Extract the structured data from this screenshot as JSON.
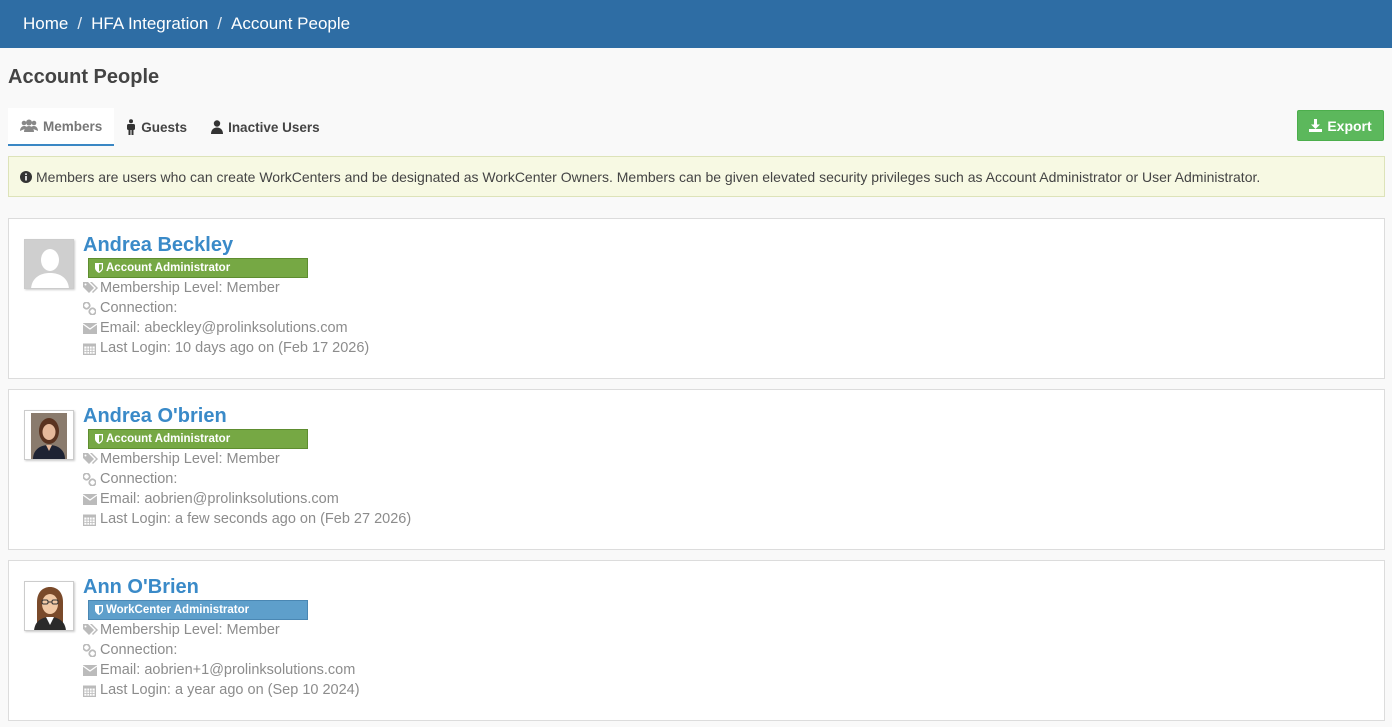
{
  "breadcrumb": [
    {
      "label": "Home"
    },
    {
      "label": "HFA Integration"
    },
    {
      "label": "Account People"
    }
  ],
  "page_title": "Account People",
  "tabs": [
    {
      "label": "Members",
      "icon": "users-icon",
      "active": true
    },
    {
      "label": "Guests",
      "icon": "male-icon",
      "active": false
    },
    {
      "label": "Inactive Users",
      "icon": "user-icon",
      "active": false
    }
  ],
  "export_label": "Export",
  "info_text": "Members are users who can create WorkCenters and be designated as WorkCenter Owners. Members can be given elevated security privileges such as Account Administrator or User Administrator.",
  "colors": {
    "topbar": "#2e6da4",
    "admin_badge": "#76a844",
    "workcenter_badge": "#5e9fcb",
    "name_link": "#3a8ac8",
    "export": "#5cb85c"
  },
  "people": [
    {
      "name": "Andrea Beckley",
      "avatar": "default-avatar",
      "role": "Account Administrator",
      "role_color": "green",
      "membership": "Membership Level: Member",
      "connection": "Connection:",
      "email": "Email: abeckley@prolinksolutions.com",
      "last_login": "Last Login: 10 days ago on (Feb 17 2026)"
    },
    {
      "name": "Andrea O'brien",
      "avatar": "photo-avatar",
      "role": "Account Administrator",
      "role_color": "green",
      "membership": "Membership Level: Member",
      "connection": "Connection:",
      "email": "Email: aobrien@prolinksolutions.com",
      "last_login": "Last Login: a few seconds ago on (Feb 27 2026)"
    },
    {
      "name": "Ann O'Brien",
      "avatar": "cartoon-avatar",
      "role": "WorkCenter Administrator",
      "role_color": "blue",
      "membership": "Membership Level: Member",
      "connection": "Connection:",
      "email": "Email: aobrien+1@prolinksolutions.com",
      "last_login": "Last Login: a year ago on (Sep 10 2024)"
    }
  ]
}
